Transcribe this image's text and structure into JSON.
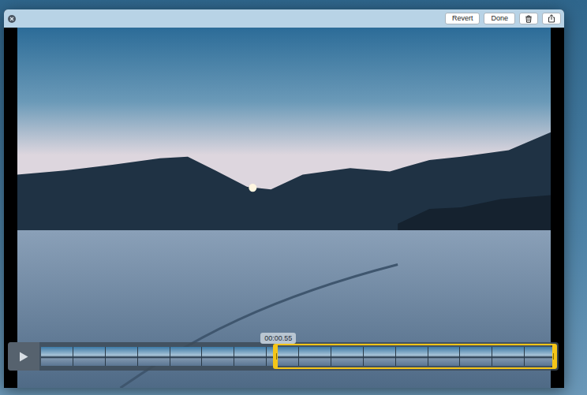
{
  "window": {
    "buttons": [
      {
        "label": "Revert"
      },
      {
        "label": "Done"
      }
    ]
  },
  "trim": {
    "time": "00:00.55",
    "start_level": 0.45,
    "end_level": 1.0
  },
  "playback": {
    "playing": false
  }
}
